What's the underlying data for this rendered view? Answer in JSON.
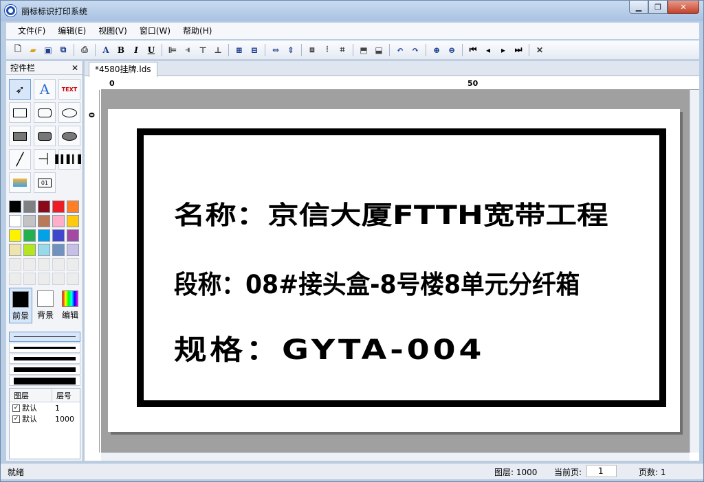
{
  "window": {
    "title": "丽标标识打印系统"
  },
  "menu": {
    "items": [
      "文件(F)",
      "编辑(E)",
      "视图(V)",
      "窗口(W)",
      "帮助(H)"
    ]
  },
  "toolbar": {
    "icons": [
      "new-icon",
      "open-icon",
      "save-icon",
      "save-all-icon",
      "print-icon",
      "font-color-icon",
      "bold-icon",
      "italic-icon",
      "underline-icon",
      "align-left-icon",
      "align-right-icon",
      "align-top-icon",
      "align-bottom-icon",
      "same-width-icon",
      "same-height-icon",
      "h-spacing-icon",
      "v-spacing-icon",
      "group-icon",
      "ungroup-icon",
      "grid-icon",
      "bring-front-icon",
      "send-back-icon",
      "undo-icon",
      "redo-icon",
      "zoom-in-icon",
      "zoom-out-icon",
      "first-page-icon",
      "prev-page-icon",
      "next-page-icon",
      "last-page-icon",
      "close-icon"
    ]
  },
  "sidebar": {
    "title": "控件栏",
    "palette": [
      "#000000",
      "#808080",
      "#8b0a1a",
      "#ee1c24",
      "#ff7f27",
      "#ffffff",
      "#c3c3c3",
      "#b97a57",
      "#ffaec9",
      "#ffc90e",
      "#fff200",
      "#22b14c",
      "#00a2e8",
      "#3f48cc",
      "#a349a4",
      "#efe4b0",
      "#b5e61d",
      "#99d9ea",
      "#7092be",
      "#c8bfe7"
    ],
    "fg_label": "前景",
    "bg_label": "背景",
    "edit_label": "编辑",
    "layers": {
      "col_layer": "图层",
      "col_num": "层号",
      "rows": [
        {
          "name": "默认",
          "num": "1"
        },
        {
          "name": "默认",
          "num": "1000"
        }
      ]
    }
  },
  "doc": {
    "tab": "*4580挂牌.lds",
    "ruler": {
      "h0": "0",
      "h50": "50",
      "v0": "0"
    },
    "label_lines": {
      "line1": "名称：京信大厦FTTH宽带工程",
      "line2": "段称：08#接头盒-8号楼8单元分纤箱",
      "line3": "规格：GYTA-004"
    }
  },
  "status": {
    "ready": "就绪",
    "layer": "图层: 1000",
    "current_page_label": "当前页:",
    "current_page": "1",
    "pages": "页数: 1"
  }
}
